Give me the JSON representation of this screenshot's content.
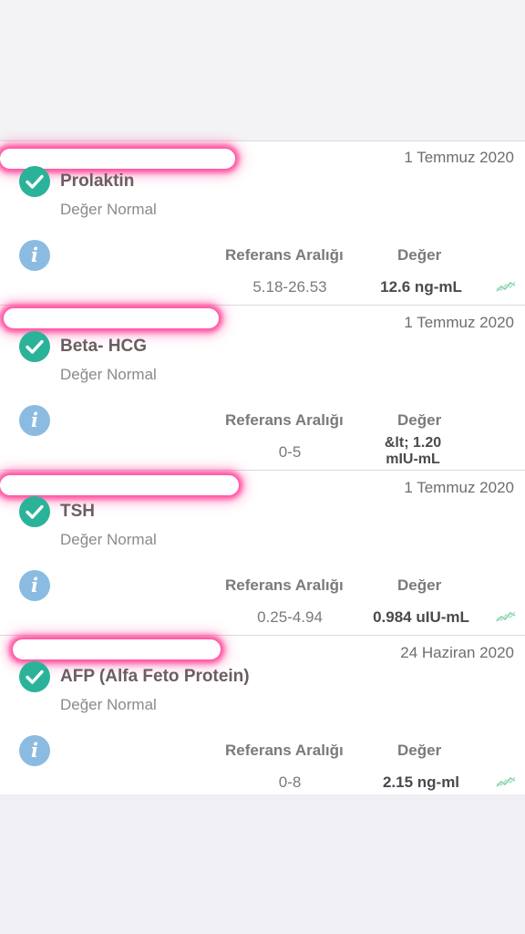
{
  "labels": {
    "reference_header": "Referans Aralığı",
    "value_header": "Değer"
  },
  "colors": {
    "check": "#2bb39a",
    "info": "#8bbbe0",
    "trend": "#7fd0a8",
    "redaction_glow": "#ff4fa0"
  },
  "results": [
    {
      "date": "1 Temmuz 2020",
      "test_name": "Prolaktin",
      "status": "Değer Normal",
      "reference_range": "5.18-26.53",
      "value": "12.6 ng-mL",
      "has_trend_icon": true
    },
    {
      "date": "1 Temmuz 2020",
      "test_name": "Beta- HCG",
      "status": "Değer Normal",
      "reference_range": "0-5",
      "value_line1": "&lt; 1.20",
      "value_line2": "mIU-mL",
      "has_trend_icon": false
    },
    {
      "date": "1 Temmuz 2020",
      "test_name": "TSH",
      "status": "Değer Normal",
      "reference_range": "0.25-4.94",
      "value": "0.984 uIU-mL",
      "has_trend_icon": true
    },
    {
      "date": "24 Haziran 2020",
      "test_name": "AFP (Alfa Feto Protein)",
      "status": "Değer Normal",
      "reference_range": "0-8",
      "value": "2.15 ng-ml",
      "has_trend_icon": true
    }
  ]
}
